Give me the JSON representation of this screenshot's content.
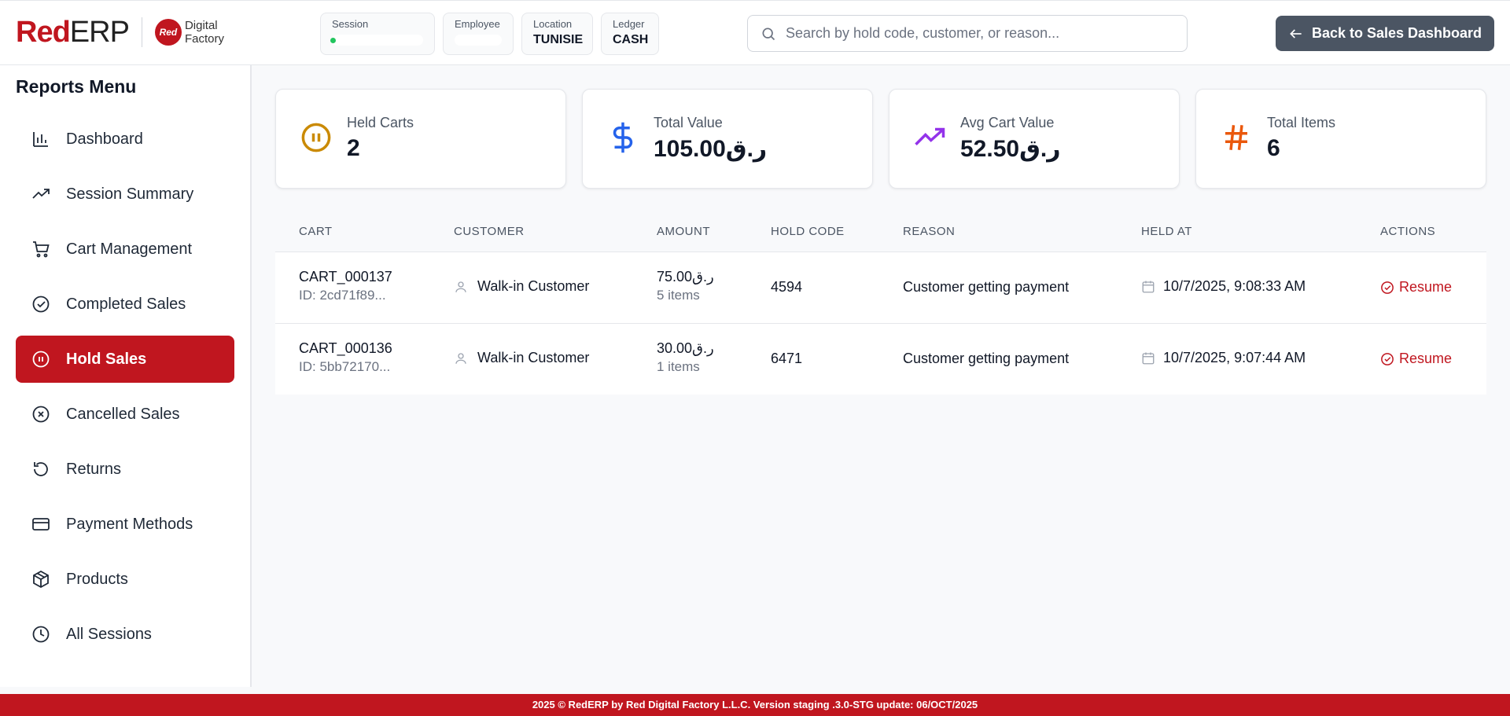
{
  "header": {
    "logo": {
      "red": "Red",
      "erp": "ERP",
      "badge": "Red",
      "df_line1": "Digital",
      "df_line2": "Factory"
    },
    "session_label": "Session",
    "employee_label": "Employee",
    "location_label": "Location",
    "location_value": "TUNISIE",
    "ledger_label": "Ledger",
    "ledger_value": "CASH",
    "search_placeholder": "Search by hold code, customer, or reason...",
    "back_button": "Back to Sales Dashboard"
  },
  "sidebar": {
    "title": "Reports Menu",
    "items": [
      {
        "label": "Dashboard",
        "icon": "bar-chart-icon"
      },
      {
        "label": "Session Summary",
        "icon": "trending-up-icon"
      },
      {
        "label": "Cart Management",
        "icon": "cart-icon"
      },
      {
        "label": "Completed Sales",
        "icon": "check-circle-icon"
      },
      {
        "label": "Hold Sales",
        "icon": "pause-circle-icon",
        "active": true
      },
      {
        "label": "Cancelled Sales",
        "icon": "x-circle-icon"
      },
      {
        "label": "Returns",
        "icon": "rotate-ccw-icon"
      },
      {
        "label": "Payment Methods",
        "icon": "credit-card-icon"
      },
      {
        "label": "Products",
        "icon": "package-icon"
      },
      {
        "label": "All Sessions",
        "icon": "clock-icon"
      }
    ]
  },
  "stats": [
    {
      "label": "Held Carts",
      "value": "2",
      "icon": "pause-circle-icon",
      "color": "#ca8a04"
    },
    {
      "label": "Total Value",
      "value": "105.00ر.ق",
      "icon": "dollar-icon",
      "color": "#2563eb"
    },
    {
      "label": "Avg Cart Value",
      "value": "52.50ر.ق",
      "icon": "trending-up-icon",
      "color": "#9333ea"
    },
    {
      "label": "Total Items",
      "value": "6",
      "icon": "hash-icon",
      "color": "#ea580c"
    }
  ],
  "table": {
    "headers": [
      "CART",
      "CUSTOMER",
      "AMOUNT",
      "HOLD CODE",
      "REASON",
      "HELD AT",
      "ACTIONS"
    ],
    "rows": [
      {
        "cart": "CART_000137",
        "cart_id": "ID: 2cd71f89...",
        "customer": "Walk-in Customer",
        "amount": "75.00ر.ق",
        "items": "5 items",
        "hold_code": "4594",
        "reason": "Customer getting payment",
        "held_at": "10/7/2025, 9:08:33 AM",
        "action": "Resume"
      },
      {
        "cart": "CART_000136",
        "cart_id": "ID: 5bb72170...",
        "customer": "Walk-in Customer",
        "amount": "30.00ر.ق",
        "items": "1 items",
        "hold_code": "6471",
        "reason": "Customer getting payment",
        "held_at": "10/7/2025, 9:07:44 AM",
        "action": "Resume"
      }
    ]
  },
  "footer": "2025 © RedERP by Red Digital Factory L.L.C. Version staging .3.0-STG update: 06/OCT/2025",
  "colors": {
    "brand": "#c0161f",
    "back_button": "#4b5563"
  }
}
